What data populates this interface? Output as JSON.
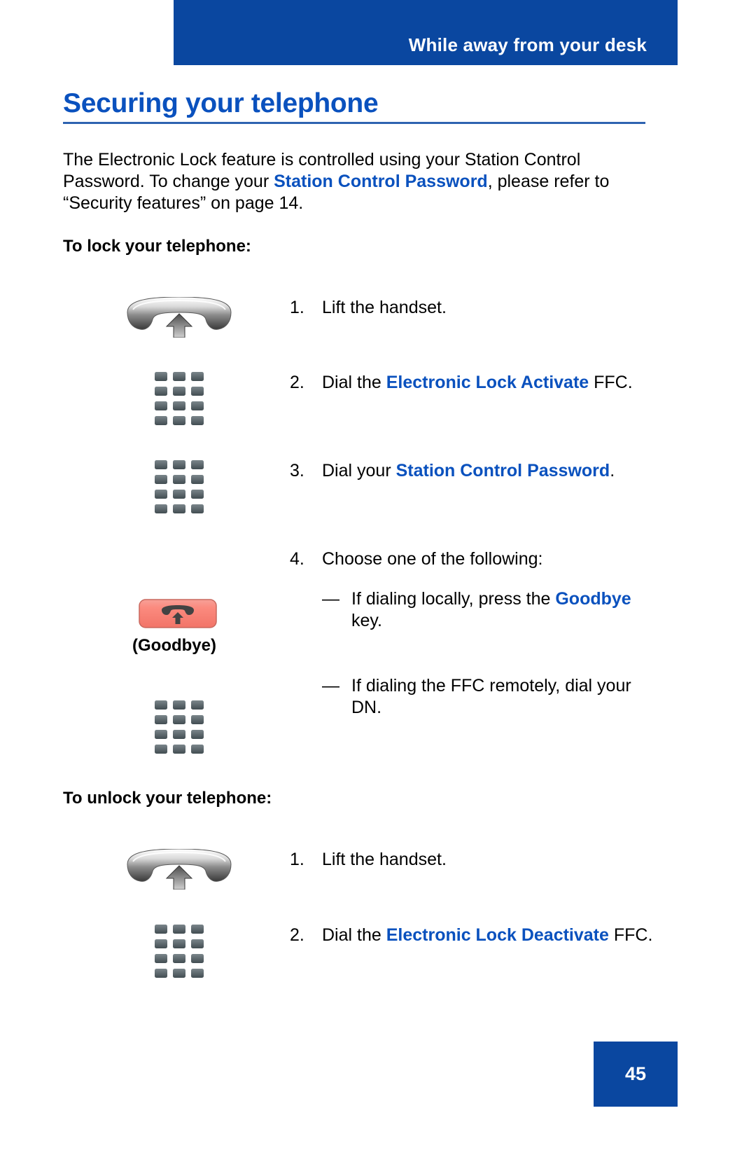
{
  "header": {
    "running_head": "While away from your desk"
  },
  "title": {
    "text": "Securing your telephone"
  },
  "intro": {
    "part1": "The Electronic Lock feature is controlled using your Station Control Password. To change your ",
    "emphasis": "Station Control Password",
    "part2": ", please refer to “Security features” on page 14."
  },
  "sections": [
    {
      "heading": "To lock your telephone:",
      "steps": [
        {
          "number": "1.",
          "text_before": "Lift the handset.",
          "emphasis": "",
          "text_after": "",
          "icon": "handset-lift-icon"
        },
        {
          "number": "2.",
          "text_before": "Dial the ",
          "emphasis": "Electronic Lock Activate",
          "text_after": " FFC.",
          "icon": "keypad-icon"
        },
        {
          "number": "3.",
          "text_before": "Dial your ",
          "emphasis": "Station Control Password",
          "text_after": ".",
          "icon": "keypad-icon"
        },
        {
          "number": "4.",
          "text_before": "Choose one of the following:",
          "emphasis": "",
          "text_after": "",
          "icon": ""
        }
      ],
      "substeps": [
        {
          "dash": "—",
          "text_before": "If dialing locally, press the ",
          "emphasis": "Goodbye",
          "text_after": " key.",
          "icon": "goodbye-key-icon",
          "icon_label": "(Goodbye)"
        },
        {
          "dash": "—",
          "text_before": "If dialing the FFC remotely, dial your DN.",
          "emphasis": "",
          "text_after": "",
          "icon": "keypad-icon",
          "icon_label": ""
        }
      ]
    },
    {
      "heading": "To unlock your telephone:",
      "steps": [
        {
          "number": "1.",
          "text_before": "Lift the handset.",
          "emphasis": "",
          "text_after": "",
          "icon": "handset-lift-icon"
        },
        {
          "number": "2.",
          "text_before": "Dial the ",
          "emphasis": "Electronic Lock Deactivate",
          "text_after": " FFC.",
          "icon": "keypad-icon"
        }
      ],
      "substeps": []
    }
  ],
  "footer": {
    "page_number": "45"
  },
  "colors": {
    "banner_blue": "#0A47A0",
    "title_blue": "#0A51BE",
    "emphasis_blue": "#0A51BE",
    "goodbye_key_red": "#F98478",
    "keypad_gray": "#525E63"
  }
}
